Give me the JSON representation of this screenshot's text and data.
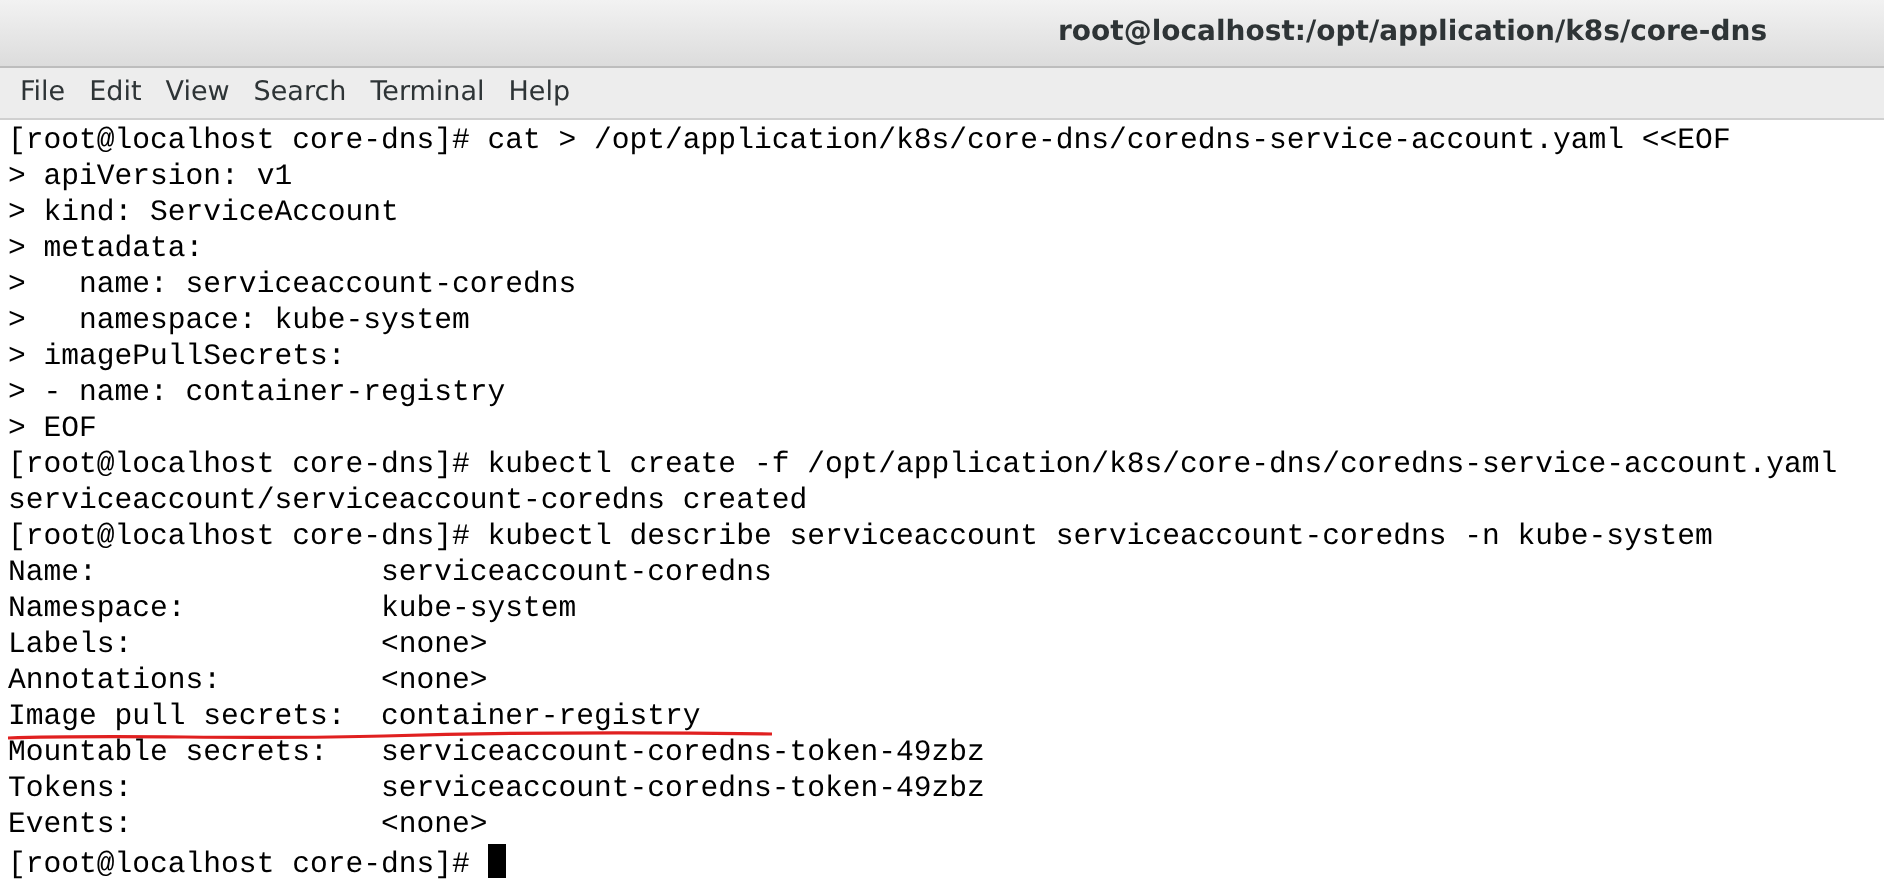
{
  "window": {
    "title": "root@localhost:/opt/application/k8s/core-dns"
  },
  "menu": [
    "File",
    "Edit",
    "View",
    "Search",
    "Terminal",
    "Help"
  ],
  "lines": [
    {
      "text": "[root@localhost core-dns]# cat > /opt/application/k8s/core-dns/coredns-service-account.yaml <<EOF",
      "underlined": false,
      "cursor": false
    },
    {
      "text": "> apiVersion: v1",
      "underlined": false,
      "cursor": false
    },
    {
      "text": "> kind: ServiceAccount",
      "underlined": false,
      "cursor": false
    },
    {
      "text": "> metadata:",
      "underlined": false,
      "cursor": false
    },
    {
      "text": ">   name: serviceaccount-coredns",
      "underlined": false,
      "cursor": false
    },
    {
      "text": ">   namespace: kube-system",
      "underlined": false,
      "cursor": false
    },
    {
      "text": "> imagePullSecrets:",
      "underlined": false,
      "cursor": false
    },
    {
      "text": "> - name: container-registry",
      "underlined": false,
      "cursor": false
    },
    {
      "text": "> EOF",
      "underlined": false,
      "cursor": false
    },
    {
      "text": "[root@localhost core-dns]# kubectl create -f /opt/application/k8s/core-dns/coredns-service-account.yaml",
      "underlined": false,
      "cursor": false
    },
    {
      "text": "serviceaccount/serviceaccount-coredns created",
      "underlined": false,
      "cursor": false
    },
    {
      "text": "[root@localhost core-dns]# kubectl describe serviceaccount serviceaccount-coredns -n kube-system",
      "underlined": false,
      "cursor": false
    },
    {
      "text": "Name:                serviceaccount-coredns",
      "underlined": false,
      "cursor": false
    },
    {
      "text": "Namespace:           kube-system",
      "underlined": false,
      "cursor": false
    },
    {
      "text": "Labels:              <none>",
      "underlined": false,
      "cursor": false
    },
    {
      "text": "Annotations:         <none>",
      "underlined": false,
      "cursor": false
    },
    {
      "text": "Image pull secrets:  container-registry",
      "underlined": true,
      "cursor": false
    },
    {
      "text": "Mountable secrets:   serviceaccount-coredns-token-49zbz",
      "underlined": false,
      "cursor": false
    },
    {
      "text": "Tokens:              serviceaccount-coredns-token-49zbz",
      "underlined": false,
      "cursor": false
    },
    {
      "text": "Events:              <none>",
      "underlined": false,
      "cursor": false
    },
    {
      "text": "[root@localhost core-dns]# ",
      "underlined": false,
      "cursor": true
    }
  ]
}
